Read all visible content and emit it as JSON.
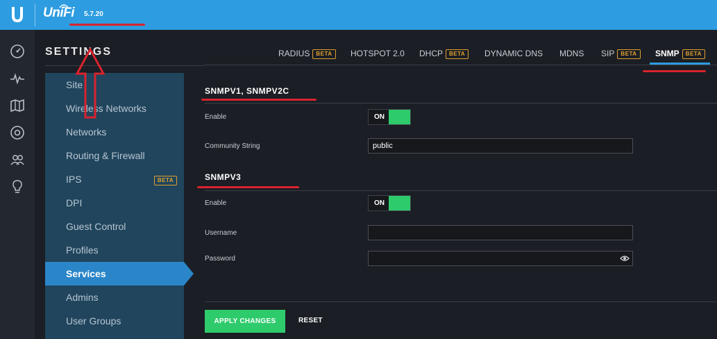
{
  "topbar": {
    "logo_text": "UniFi",
    "version": "5.7.20"
  },
  "rail": {
    "icons": [
      "dashboard-icon",
      "statistics-icon",
      "map-icon",
      "devices-icon",
      "clients-icon",
      "insights-icon"
    ]
  },
  "settings": {
    "title": "SETTINGS",
    "items": [
      {
        "label": "Site"
      },
      {
        "label": "Wireless Networks"
      },
      {
        "label": "Networks"
      },
      {
        "label": "Routing & Firewall"
      },
      {
        "label": "IPS",
        "badge": "BETA"
      },
      {
        "label": "DPI"
      },
      {
        "label": "Guest Control"
      },
      {
        "label": "Profiles"
      },
      {
        "label": "Services",
        "active": true
      },
      {
        "label": "Admins"
      },
      {
        "label": "User Groups"
      }
    ]
  },
  "tabs": [
    {
      "label": "RADIUS",
      "badge": "BETA"
    },
    {
      "label": "HOTSPOT 2.0"
    },
    {
      "label": "DHCP",
      "badge": "BETA"
    },
    {
      "label": "DYNAMIC DNS"
    },
    {
      "label": "MDNS"
    },
    {
      "label": "SIP",
      "badge": "BETA"
    },
    {
      "label": "SNMP",
      "badge": "BETA",
      "active": true
    }
  ],
  "snmpv1": {
    "title": "SNMPV1, SNMPV2C",
    "enable_label": "Enable",
    "enable_state": "ON",
    "community_label": "Community String",
    "community_value": "public"
  },
  "snmpv3": {
    "title": "SNMPV3",
    "enable_label": "Enable",
    "enable_state": "ON",
    "username_label": "Username",
    "username_value": "",
    "password_label": "Password",
    "password_value": ""
  },
  "actions": {
    "apply_label": "APPLY CHANGES",
    "reset_label": "RESET"
  },
  "colors": {
    "topbar": "#2d9ce0",
    "accent_green": "#2ecb6c",
    "nav_bg": "#20455d",
    "nav_active": "#2a86c8",
    "annotation_red": "#d9232d",
    "beta_orange": "#e0a030"
  }
}
